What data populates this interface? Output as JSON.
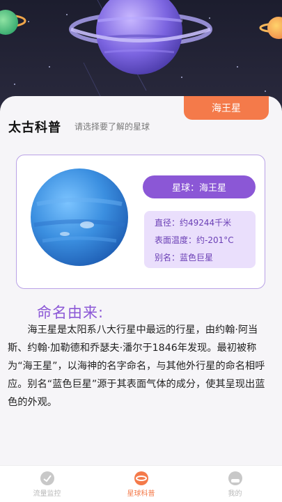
{
  "header": {
    "app_title": "太古科普",
    "subtitle": "请选择要了解的星球",
    "selected_tab": "海王星"
  },
  "planet_card": {
    "name_label": "星球：海王星",
    "info": {
      "diameter": "直径：约49244千米",
      "surface_temp": "表面温度：约-201°C",
      "alias": "别名：蓝色巨星"
    }
  },
  "naming": {
    "title": "命名由来:",
    "text": "海王星是太阳系八大行星中最远的行星，由约翰·阿当斯、约翰·加勒德和乔瑟夫·潘尔于1846年发现。最初被称为“海王星”，以海神的名字命名，与其他外行星的命名相呼应。别名“蓝色巨星”源于其表面气体的成分，使其呈现出蓝色的外观。"
  },
  "tabbar": {
    "items": [
      {
        "label": "流量监控",
        "icon": "gauge-icon"
      },
      {
        "label": "星球科普",
        "icon": "planet-icon"
      },
      {
        "label": "我的",
        "icon": "profile-icon"
      }
    ],
    "active_color": "#f47a4a",
    "inactive_color": "#b9b9b9"
  },
  "colors": {
    "accent_purple": "#8b57d6",
    "accent_orange": "#f47a4a",
    "neptune_blue": "#3b8fe0"
  }
}
